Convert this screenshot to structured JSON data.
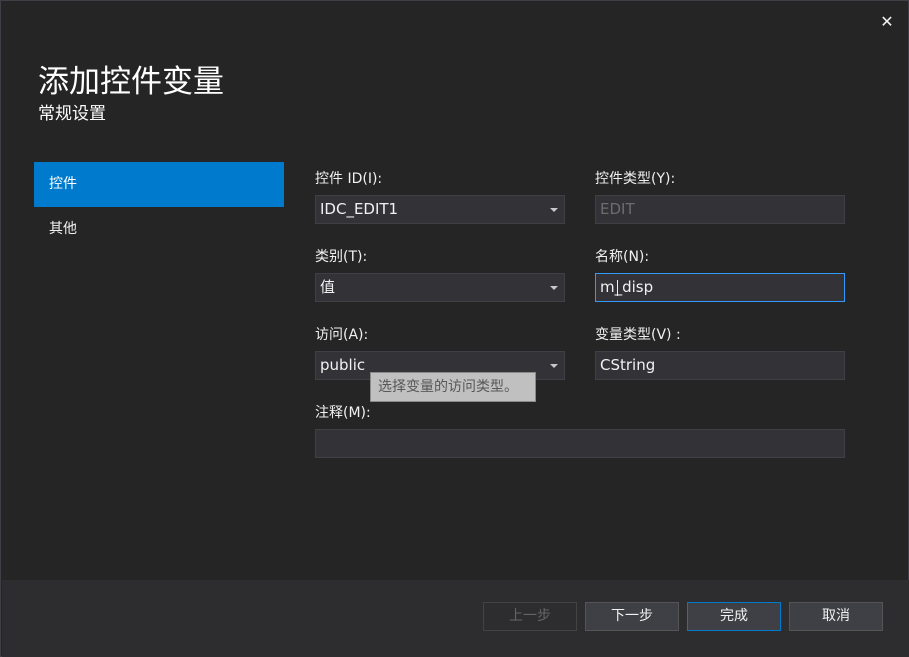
{
  "dialog": {
    "title": "添加控件变量",
    "subtitle": "常规设置",
    "close_glyph": "✕"
  },
  "nav": {
    "items": [
      {
        "label": "控件",
        "active": true
      },
      {
        "label": "其他",
        "active": false
      }
    ]
  },
  "form": {
    "control_id": {
      "label": "控件 ID(I):",
      "value": "IDC_EDIT1"
    },
    "control_type": {
      "label": "控件类型(Y):",
      "value": "EDIT"
    },
    "category": {
      "label": "类别(T):",
      "value": "值"
    },
    "name": {
      "label": "名称(N):",
      "value": "m_disp"
    },
    "access": {
      "label": "访问(A):",
      "value": "public"
    },
    "variable_type": {
      "label": "变量类型(V) :",
      "value": "CString"
    },
    "comment": {
      "label": "注释(M):",
      "value": ""
    }
  },
  "tooltip": {
    "text": "选择变量的访问类型。"
  },
  "footer": {
    "prev_label": "上一步",
    "next_label": "下一步",
    "finish_label": "完成",
    "cancel_label": "取消"
  },
  "colors": {
    "accent": "#007acc",
    "background": "#252526",
    "footer": "#2d2d30"
  }
}
